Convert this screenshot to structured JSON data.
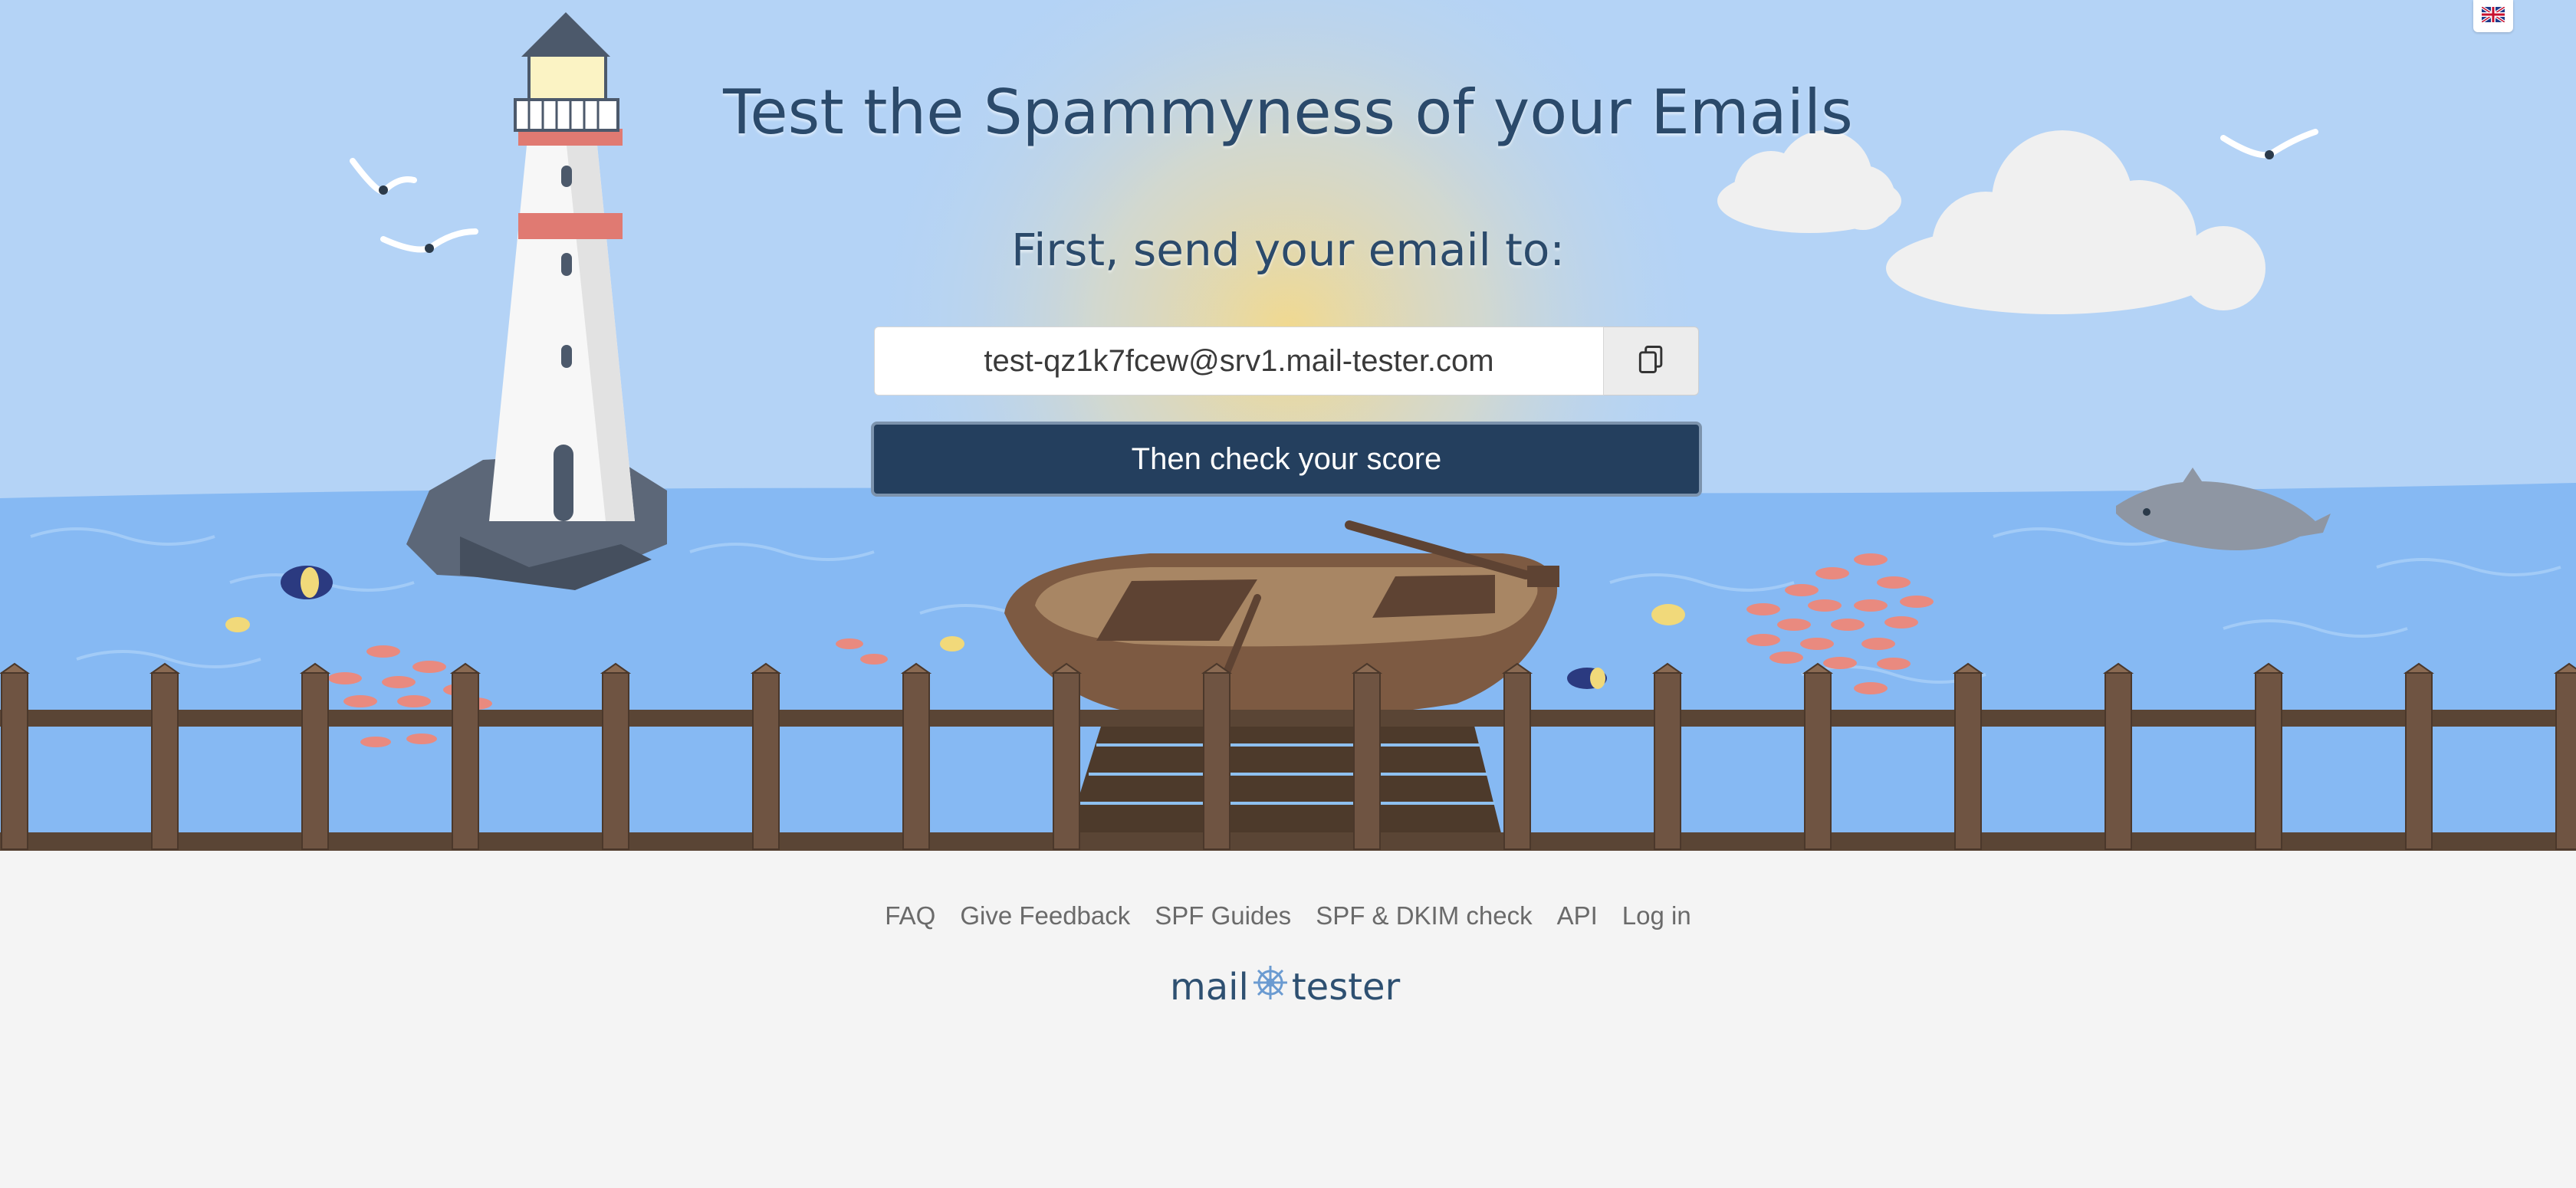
{
  "hero": {
    "title": "Test the Spammyness of your Emails",
    "subtitle": "First, send your email to:",
    "email_value": "test-qz1k7fcew@srv1.mail-tester.com",
    "copy_icon": "copy-icon",
    "check_button_label": "Then check your score",
    "language_icon": "uk-flag-icon"
  },
  "footer": {
    "links": [
      "FAQ",
      "Give Feedback",
      "SPF Guides",
      "SPF & DKIM check",
      "API",
      "Log in"
    ],
    "logo_left": "mail",
    "logo_right": "tester",
    "logo_icon": "ship-wheel-icon"
  },
  "colors": {
    "sky": "#b4d3f6",
    "sea": "#86b9f3",
    "button": "#243f5e",
    "title": "#2b4a6b",
    "footer_bg": "#f4f4f4"
  }
}
